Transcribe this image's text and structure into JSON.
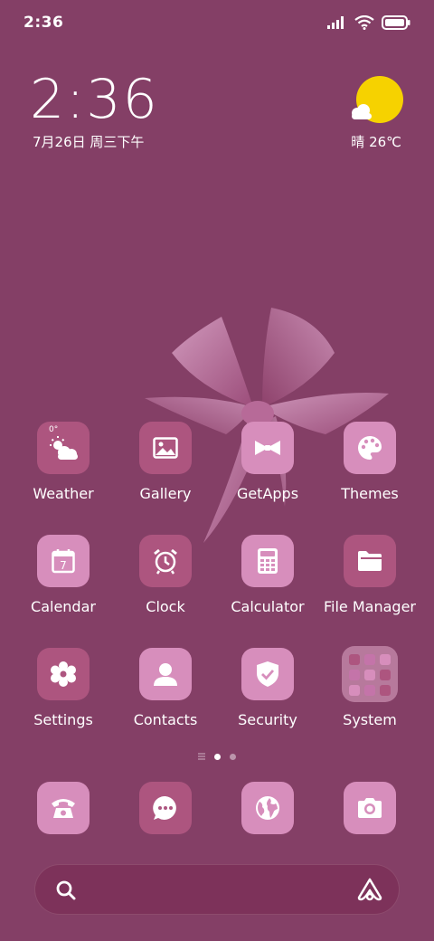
{
  "status_bar": {
    "time": "2:36"
  },
  "clock_widget": {
    "time": "2:36",
    "date": "7月26日 周三下午"
  },
  "weather_widget": {
    "text": "晴 26℃"
  },
  "apps": [
    {
      "name": "Weather",
      "icon": "weather-icon",
      "badge": "0°"
    },
    {
      "name": "Gallery",
      "icon": "gallery-icon"
    },
    {
      "name": "GetApps",
      "icon": "getapps-icon"
    },
    {
      "name": "Themes",
      "icon": "palette-icon"
    },
    {
      "name": "Calendar",
      "icon": "calendar-icon",
      "badge": "7"
    },
    {
      "name": "Clock",
      "icon": "alarm-clock-icon"
    },
    {
      "name": "Calculator",
      "icon": "calculator-icon"
    },
    {
      "name": "File Manager",
      "icon": "folder-icon"
    },
    {
      "name": "Settings",
      "icon": "settings-icon"
    },
    {
      "name": "Contacts",
      "icon": "contact-icon"
    },
    {
      "name": "Security",
      "icon": "shield-icon"
    },
    {
      "name": "System",
      "icon": "folder-grid-icon"
    }
  ],
  "dock": [
    {
      "name": "Phone",
      "icon": "phone-icon"
    },
    {
      "name": "Messages",
      "icon": "message-icon"
    },
    {
      "name": "Browser",
      "icon": "globe-icon"
    },
    {
      "name": "Camera",
      "icon": "camera-icon"
    }
  ],
  "page_indicator": {
    "pages": 2,
    "current": 1
  },
  "colors": {
    "background": "#843f66",
    "sun": "#f6d200",
    "tile_light": "#d78ebc",
    "tile_dark": "#ad557f"
  }
}
